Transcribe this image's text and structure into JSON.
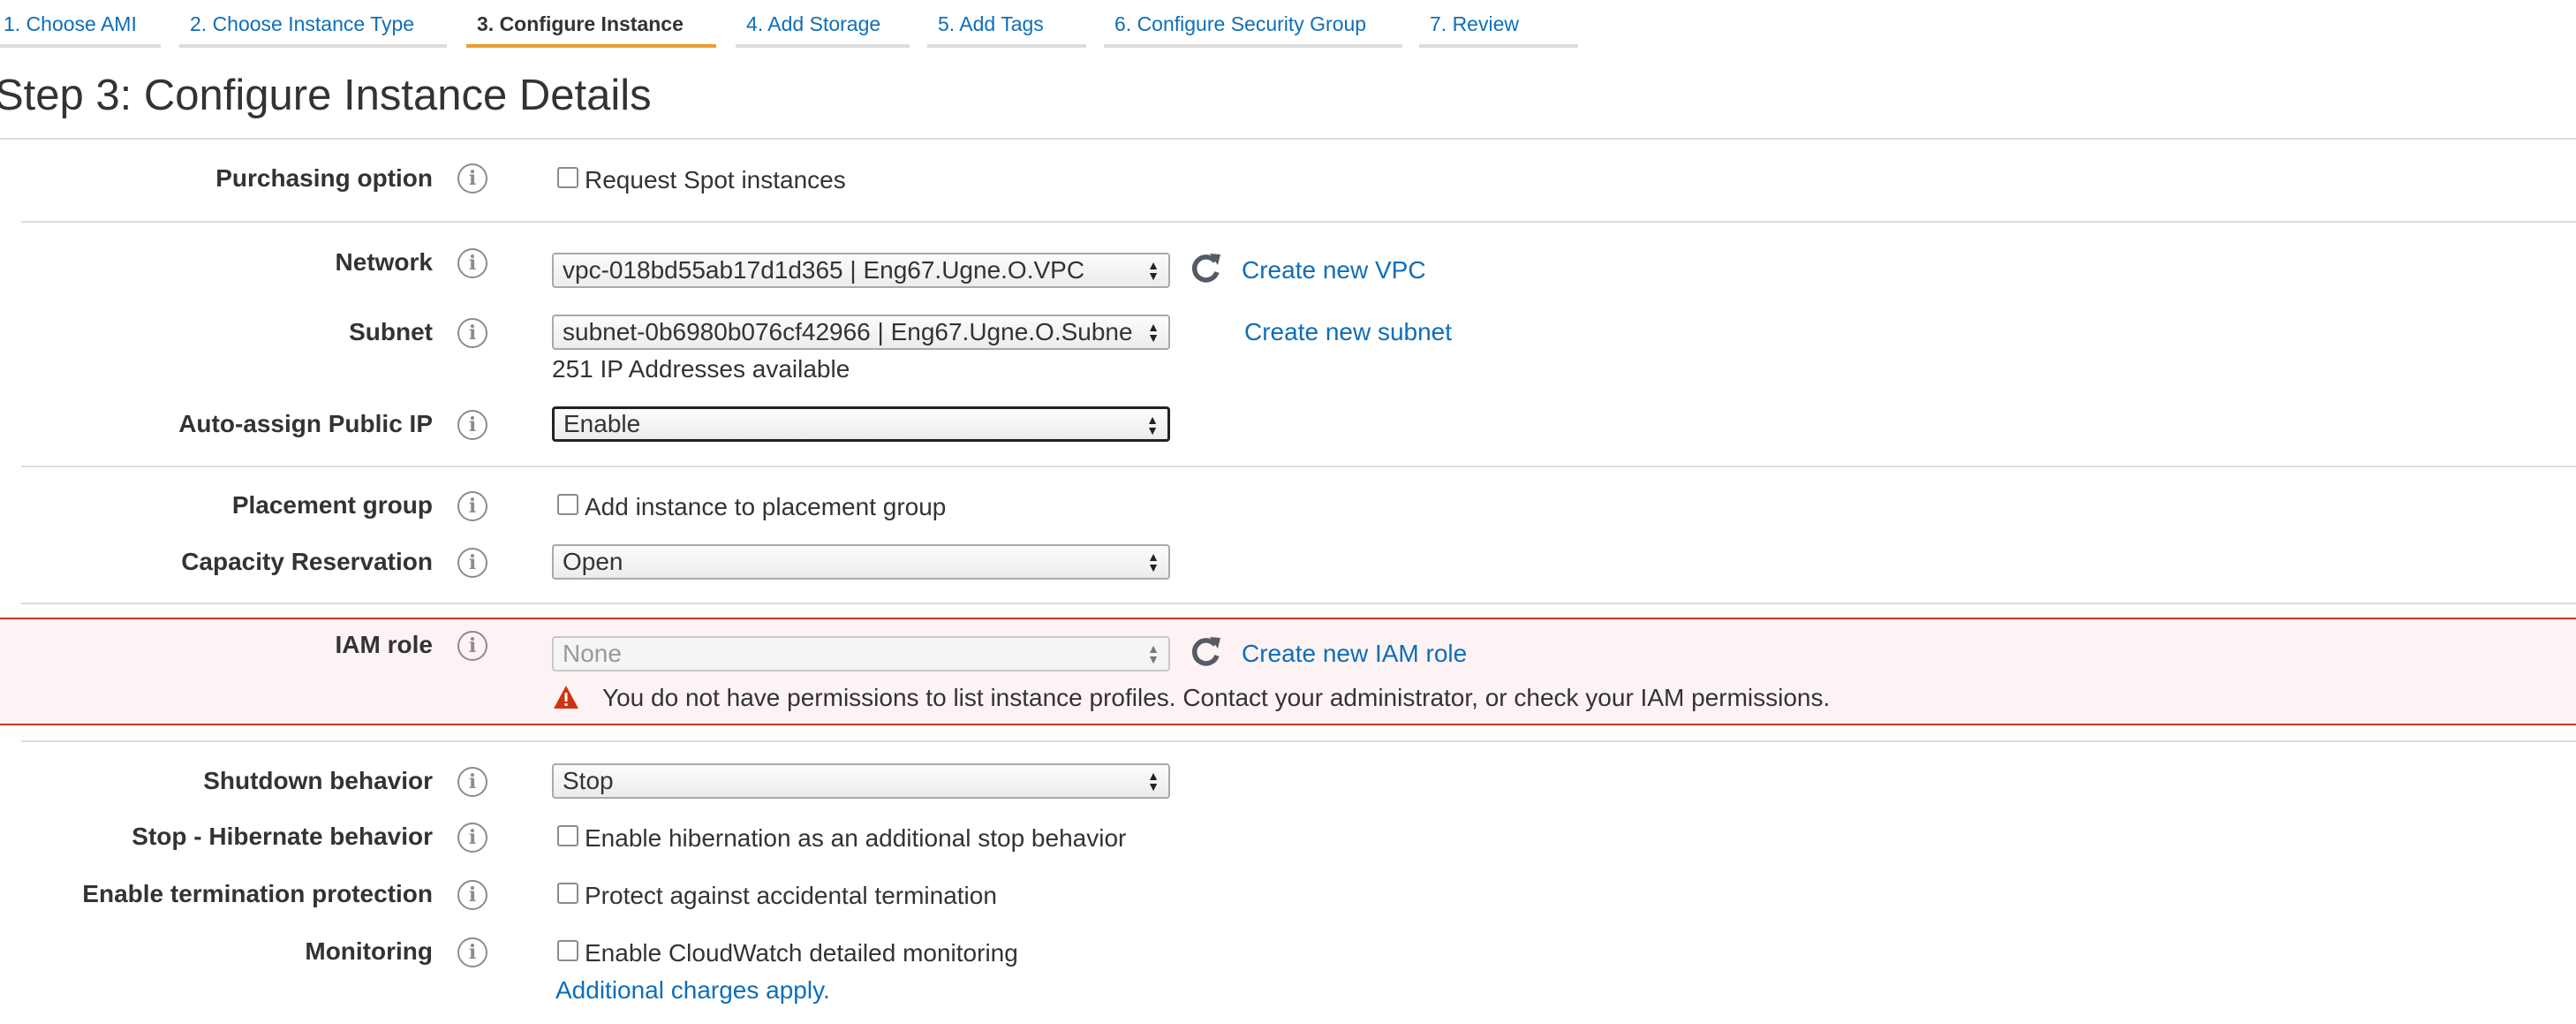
{
  "wizard": {
    "steps": [
      {
        "label": "1. Choose AMI"
      },
      {
        "label": "2. Choose Instance Type"
      },
      {
        "label": "3. Configure Instance"
      },
      {
        "label": "4. Add Storage"
      },
      {
        "label": "5. Add Tags"
      },
      {
        "label": "6. Configure Security Group"
      },
      {
        "label": "7. Review"
      }
    ],
    "active_step": 3
  },
  "page_title": "Step 3: Configure Instance Details",
  "info_icon_glyph": "i",
  "fields": {
    "purchasing": {
      "label": "Purchasing option",
      "checkbox_label": "Request Spot instances",
      "checked": false
    },
    "network": {
      "label": "Network",
      "value": "vpc-018bd55ab17d1d365 | Eng67.Ugne.O.VPC",
      "create_link": "Create new VPC"
    },
    "subnet": {
      "label": "Subnet",
      "value": "subnet-0b6980b076cf42966 | Eng67.Ugne.O.Subne",
      "available": "251 IP Addresses available",
      "create_link": "Create new subnet"
    },
    "public_ip": {
      "label": "Auto-assign Public IP",
      "value": "Enable"
    },
    "placement": {
      "label": "Placement group",
      "checkbox_label": "Add instance to placement group",
      "checked": false
    },
    "capacity": {
      "label": "Capacity Reservation",
      "value": "Open"
    },
    "iam": {
      "label": "IAM role",
      "value": "None",
      "create_link": "Create new IAM role",
      "error": "You do not have permissions to list instance profiles. Contact your administrator, or check your IAM permissions."
    },
    "shutdown": {
      "label": "Shutdown behavior",
      "value": "Stop"
    },
    "hibernate": {
      "label": "Stop - Hibernate behavior",
      "checkbox_label": "Enable hibernation as an additional stop behavior",
      "checked": false
    },
    "termination": {
      "label": "Enable termination protection",
      "checkbox_label": "Protect against accidental termination",
      "checked": false
    },
    "monitoring": {
      "label": "Monitoring",
      "checkbox_label": "Enable CloudWatch detailed monitoring",
      "checked": false,
      "note_link": "Additional charges apply."
    }
  },
  "icons": {
    "info": "info-icon",
    "refresh": "refresh-icon",
    "warning": "warning-icon",
    "select_arrows": "select-arrows-icon"
  },
  "colors": {
    "link": "#0e6eb8",
    "active_tab_underline": "#ec9f2b",
    "error_border": "#d13212",
    "error_background": "#fdf3f4",
    "warning_icon": "#d13212"
  }
}
